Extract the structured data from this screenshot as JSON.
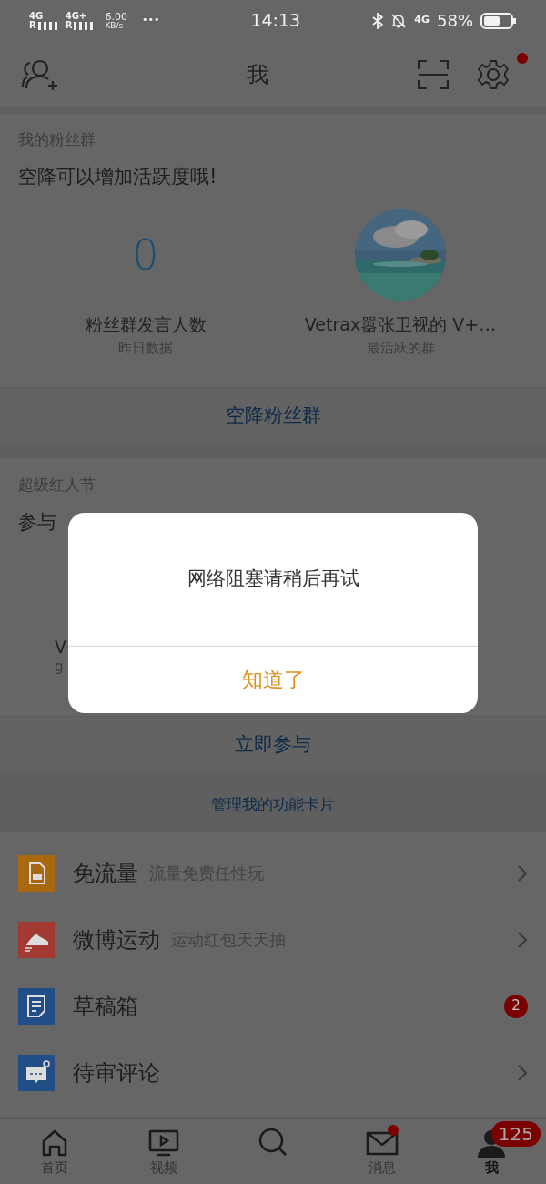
{
  "status_bar": {
    "signals": [
      {
        "network": "4G",
        "roaming": "R"
      },
      {
        "network": "4G+",
        "roaming": "R"
      }
    ],
    "speed": "6.00",
    "speed_unit": "KB/s",
    "more": "•••",
    "time": "14:13",
    "data_network": "4G",
    "battery": "58%"
  },
  "nav_bar": {
    "title": "我",
    "settings_dot": true
  },
  "fan_group": {
    "heading": "我的粉丝群",
    "tip": "空降可以增加活跃度哦!",
    "stats": [
      {
        "kind": "number",
        "value": "0",
        "label": "粉丝群发言人数",
        "sublabel": "昨日数据"
      },
      {
        "kind": "picture",
        "label": "Vetrax嚣张卫视的 V+…",
        "sublabel": "最活跃的群"
      }
    ],
    "action": "空降粉丝群"
  },
  "red_festival": {
    "heading": "超级红人节",
    "tip": "参与",
    "card_letters": [
      "V",
      "g"
    ],
    "action": "立即参与"
  },
  "manage_cards": "管理我的功能卡片",
  "features": [
    {
      "kind": "sim",
      "color": "#a8680f",
      "title": "免流量",
      "subtitle": "流量免费任性玩",
      "arrow": true
    },
    {
      "kind": "shoe",
      "color": "#a23a33",
      "title": "微博运动",
      "subtitle": "运动红包天天抽",
      "arrow": true
    },
    {
      "kind": "draft",
      "color": "#214e86",
      "title": "草稿箱",
      "badge": "2",
      "arrow": false
    },
    {
      "kind": "comment",
      "color": "#214e86",
      "title": "待审评论",
      "arrow": true
    }
  ],
  "dialog": {
    "message": "网络阻塞请稍后再试",
    "button": "知道了"
  },
  "tab_bar": [
    {
      "kind": "home",
      "label": "首页",
      "selected": false,
      "dot": false
    },
    {
      "kind": "video",
      "label": "视频",
      "selected": false,
      "dot": false
    },
    {
      "kind": "search",
      "selected": false,
      "dot": false
    },
    {
      "kind": "mail",
      "label": "消息",
      "selected": false,
      "dot": true
    },
    {
      "kind": "person",
      "label": "我",
      "selected": true,
      "dot": false,
      "badge": "125"
    }
  ]
}
